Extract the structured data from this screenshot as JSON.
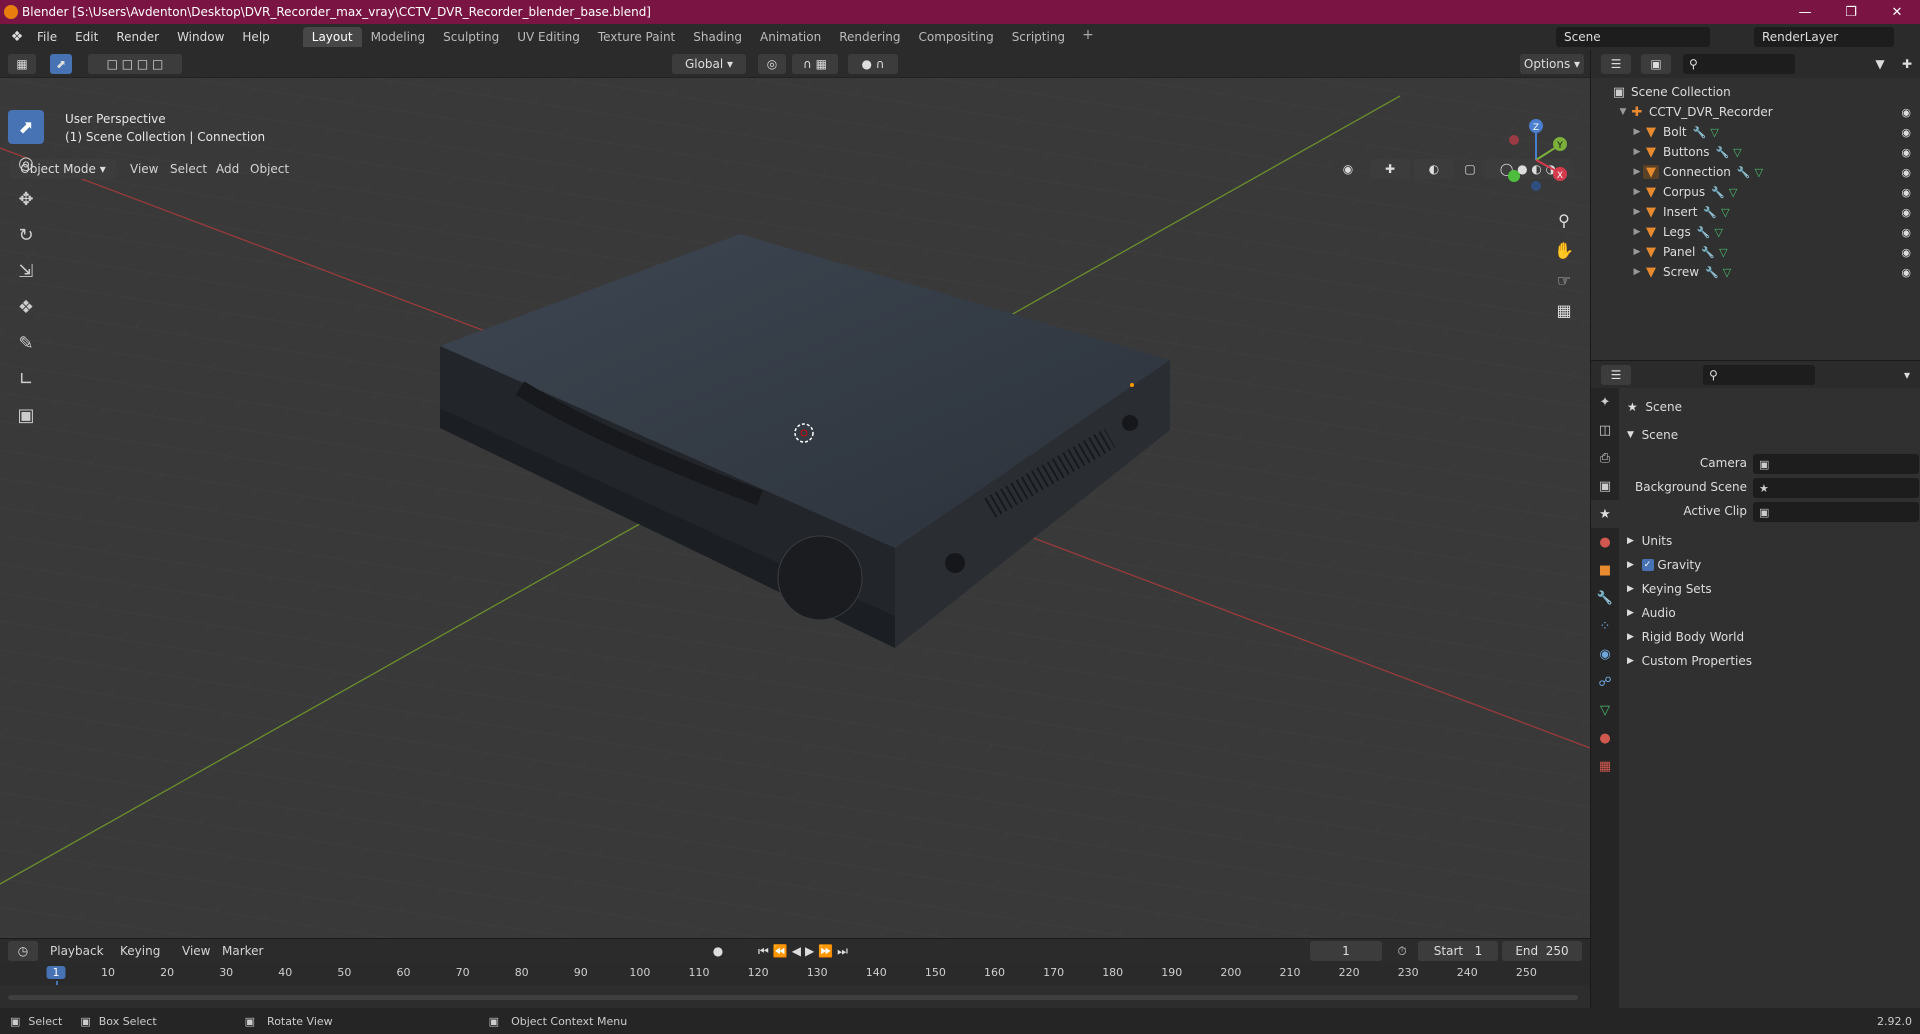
{
  "titlebar": {
    "title": "Blender [S:\\Users\\Avdenton\\Desktop\\DVR_Recorder_max_vray\\CCTV_DVR_Recorder_blender_base.blend]"
  },
  "menu": [
    "File",
    "Edit",
    "Render",
    "Window",
    "Help"
  ],
  "workspaces": [
    "Layout",
    "Modeling",
    "Sculpting",
    "UV Editing",
    "Texture Paint",
    "Shading",
    "Animation",
    "Rendering",
    "Compositing",
    "Scripting"
  ],
  "scene": {
    "name": "Scene",
    "view_layer": "RenderLayer"
  },
  "header": {
    "transform": "Global",
    "options": "Options",
    "mode": "Object Mode",
    "menus": [
      "View",
      "Select",
      "Add",
      "Object"
    ]
  },
  "viewport": {
    "perspective": "User Perspective",
    "context": "(1) Scene Collection | Connection",
    "axis_x": "X",
    "axis_y": "Y",
    "axis_z": "Z"
  },
  "outliner": {
    "root": "Scene Collection",
    "collection": "CCTV_DVR_Recorder",
    "objects": [
      "Bolt",
      "Buttons",
      "Connection",
      "Corpus",
      "Insert",
      "Legs",
      "Panel",
      "Screw"
    ]
  },
  "properties": {
    "context": "Scene",
    "section": "Scene",
    "fields": [
      {
        "label": "Camera"
      },
      {
        "label": "Background Scene"
      },
      {
        "label": "Active Clip"
      }
    ],
    "panels": [
      "Units",
      "Gravity",
      "Keying Sets",
      "Audio",
      "Rigid Body World",
      "Custom Properties"
    ]
  },
  "timeline": {
    "menus": [
      "Playback",
      "Keying",
      "View",
      "Marker"
    ],
    "current_frame": "1",
    "start_label": "Start",
    "start": "1",
    "end_label": "End",
    "end": "250",
    "ticks": [
      "1",
      "10",
      "20",
      "30",
      "40",
      "50",
      "60",
      "70",
      "80",
      "90",
      "100",
      "110",
      "120",
      "130",
      "140",
      "150",
      "160",
      "170",
      "180",
      "190",
      "200",
      "210",
      "220",
      "230",
      "240",
      "250"
    ]
  },
  "status": {
    "select": "Select",
    "box_select": "Box Select",
    "rotate": "Rotate View",
    "context_menu": "Object Context Menu",
    "version": "2.92.0"
  }
}
